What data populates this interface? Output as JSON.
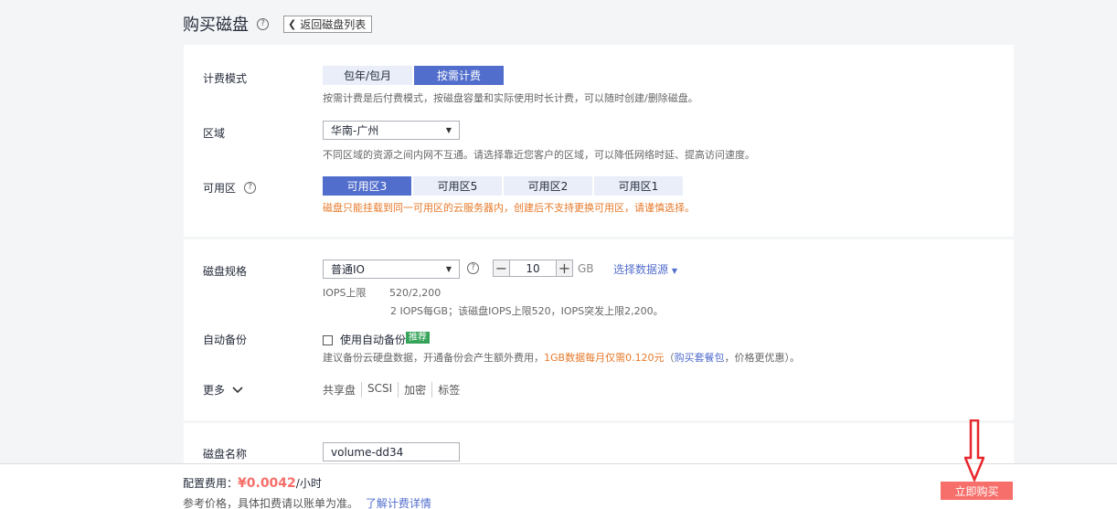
{
  "header": {
    "title": "购买磁盘",
    "help": "?",
    "back_label": "返回磁盘列表"
  },
  "billing": {
    "label": "计费模式",
    "options": [
      "包年/包月",
      "按需计费"
    ],
    "selected": "按需计费",
    "hint": "按需计费是后付费模式，按磁盘容量和实际使用时长计费，可以随时创建/删除磁盘。"
  },
  "region": {
    "label": "区域",
    "value": "华南-广州",
    "hint": "不同区域的资源之间内网不互通。请选择靠近您客户的区域，可以降低网络时延、提高访问速度。"
  },
  "zone": {
    "label": "可用区",
    "options": [
      "可用区3",
      "可用区5",
      "可用区2",
      "可用区1"
    ],
    "selected": "可用区3",
    "hint": "磁盘只能挂载到同一可用区的云服务器内，创建后不支持更换可用区，请谨慎选择。"
  },
  "spec": {
    "label": "磁盘规格",
    "type": "普通IO",
    "size": "10",
    "unit": "GB",
    "datasource_link": "选择数据源",
    "iops_label": "IOPS上限",
    "iops_value": "520/2,200",
    "iops_detail": "2 IOPS每GB；该磁盘IOPS上限520，IOPS突发上限2,200。"
  },
  "backup": {
    "label": "自动备份",
    "checkbox_label": "使用自动备份",
    "badge": "推荐",
    "hint_prefix": "建议备份云硬盘数据，开通备份会产生额外费用，",
    "hint_highlight": "1GB数据每月仅需0.120元",
    "hint_paren_open": "（",
    "hint_link": "购买套餐包",
    "hint_suffix": "，价格更优惠）。"
  },
  "more": {
    "label": "更多",
    "links": [
      "共享盘",
      "SCSI",
      "加密",
      "标签"
    ]
  },
  "name": {
    "label": "磁盘名称",
    "value": "volume-dd34"
  },
  "footer": {
    "price_label": "配置费用：",
    "price": "¥0.0042",
    "price_unit": "/小时",
    "ref_text": "参考价格，具体扣费请以账单为准。",
    "ref_link": "了解计费详情",
    "buy_label": "立即购买"
  },
  "colors": {
    "accent": "#526ecc",
    "buy": "#f66f6a",
    "warn": "#e6792a",
    "arrow": "#e8262d",
    "badge": "#36a35a"
  }
}
